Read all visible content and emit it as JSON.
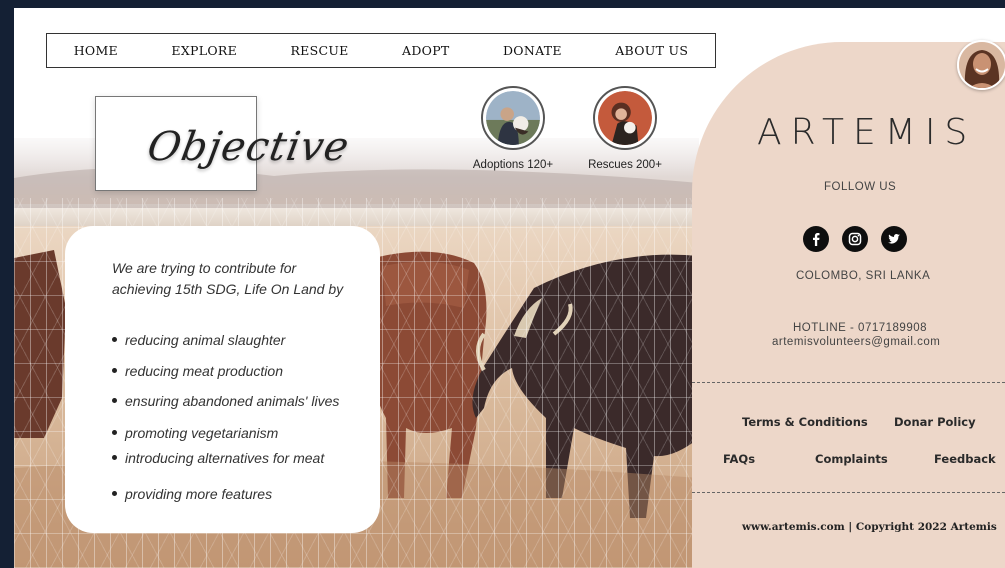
{
  "nav": {
    "items": [
      "HOME",
      "EXPLORE",
      "RESCUE",
      "ADOPT",
      "DONATE",
      "ABOUT US"
    ]
  },
  "objective": {
    "title": "Objective"
  },
  "stats": {
    "adoptions": "Adoptions 120+",
    "rescues": "Rescues 200+"
  },
  "card": {
    "intro": "We are trying to contribute for achieving 15th SDG, Life On Land by",
    "bullets": [
      "reducing animal slaughter",
      "reducing meat production",
      "ensuring abandoned animals' lives",
      "promoting vegetarianism",
      "introducing alternatives for meat",
      "providing more features"
    ]
  },
  "panel": {
    "brand": "ARTEMIS",
    "follow": "FOLLOW US",
    "social_icons": [
      "facebook-icon",
      "instagram-icon",
      "twitter-icon"
    ],
    "location": "COLOMBO, SRI LANKA",
    "hotline": "HOTLINE - 0717189908",
    "email": "artemisvolunteers@gmail.com",
    "links": {
      "terms": "Terms & Conditions",
      "donar": "Donar Policy",
      "faqs": "FAQs",
      "complaints": "Complaints",
      "feedback": "Feedback"
    },
    "copyright": "www.artemis.com | Copyright 2022 Artemis"
  },
  "colors": {
    "panel": "#edd7c9",
    "background": "#142034",
    "text": "#333333"
  }
}
